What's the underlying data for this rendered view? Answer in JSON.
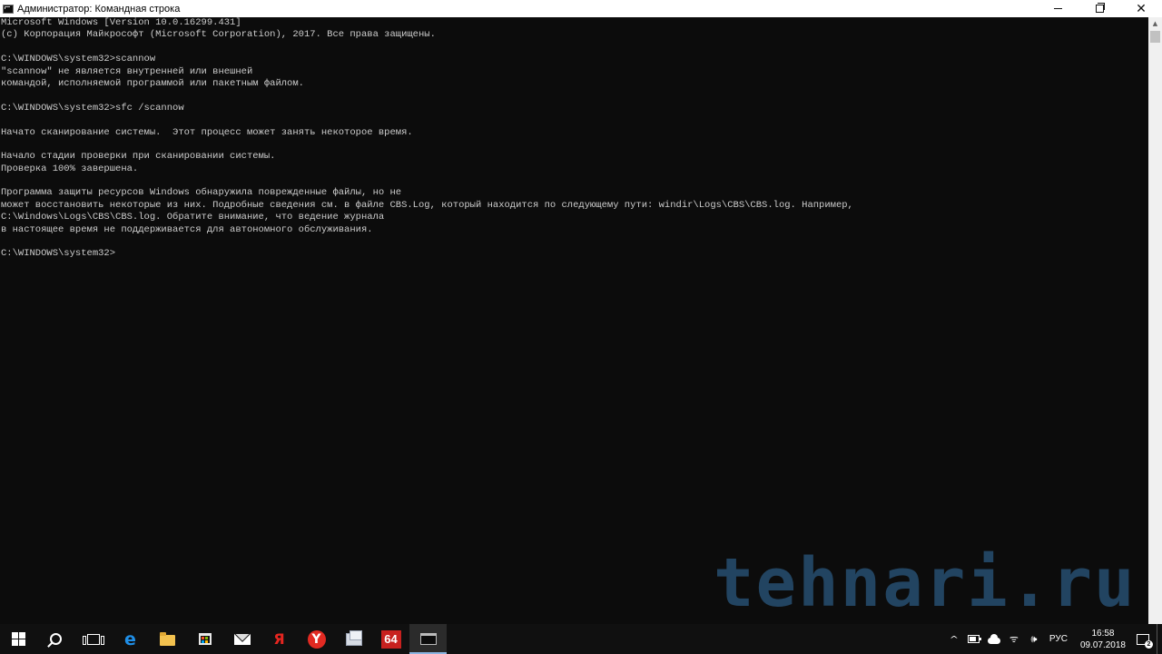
{
  "window": {
    "title": "Администратор: Командная строка",
    "controls": {
      "minimize": "—",
      "maximize": "□",
      "close": "✕"
    }
  },
  "console": {
    "text_color": "#cccccc",
    "background": "#0c0c0c",
    "lines": [
      "Microsoft Windows [Version 10.0.16299.431]",
      "(c) Корпорация Майкрософт (Microsoft Corporation), 2017. Все права защищены.",
      "",
      "C:\\WINDOWS\\system32>scannow",
      "\"scannow\" не является внутренней или внешней",
      "командой, исполняемой программой или пакетным файлом.",
      "",
      "C:\\WINDOWS\\system32>sfc /scannow",
      "",
      "Начато сканирование системы.  Этот процесс может занять некоторое время.",
      "",
      "Начало стадии проверки при сканировании системы.",
      "Проверка 100% завершена.",
      "",
      "Программа защиты ресурсов Windows обнаружила поврежденные файлы, но не",
      "может восстановить некоторые из них. Подробные сведения см. в файле CBS.Log, который находится по следующему пути: windir\\Logs\\CBS\\CBS.log. Например,",
      "C:\\Windows\\Logs\\CBS\\CBS.log. Обратите внимание, что ведение журнала",
      "в настоящее время не поддерживается для автономного обслуживания.",
      "",
      "C:\\WINDOWS\\system32>"
    ]
  },
  "watermark": {
    "text": "tehnari.ru",
    "color": "#274e70"
  },
  "taskbar": {
    "pinned": [
      {
        "name": "start",
        "icon": "windows-logo-icon"
      },
      {
        "name": "search",
        "icon": "search-icon"
      },
      {
        "name": "task-view",
        "icon": "task-view-icon"
      },
      {
        "name": "edge",
        "icon": "edge-icon",
        "glyph": "e"
      },
      {
        "name": "file-explorer",
        "icon": "folder-icon"
      },
      {
        "name": "store",
        "icon": "store-icon"
      },
      {
        "name": "mail",
        "icon": "mail-icon"
      },
      {
        "name": "yandex",
        "icon": "yandex-icon",
        "glyph": "Я"
      },
      {
        "name": "yandex-browser",
        "icon": "yandex-browser-icon",
        "glyph": "Y"
      },
      {
        "name": "app",
        "icon": "document-window-icon"
      },
      {
        "name": "aida64",
        "icon": "aida64-icon",
        "glyph": "64"
      },
      {
        "name": "command-prompt",
        "icon": "command-prompt-icon",
        "active": true
      }
    ],
    "tray": {
      "chevron": "^",
      "language": "РУС",
      "time": "16:58",
      "date": "09.07.2018",
      "notifications_count": "2"
    }
  }
}
